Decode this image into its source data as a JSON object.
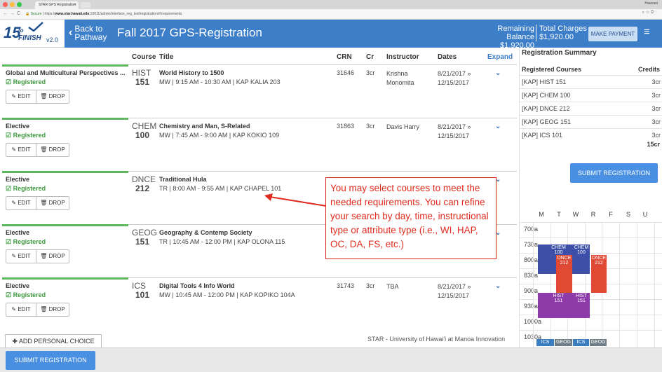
{
  "browser": {
    "tab_title": "STAR GPS Registration",
    "user": "Haunani",
    "url_secure": "Secure",
    "url_scheme": "https://",
    "url_host": "www.star.hawaii.edu",
    "url_path": ":10011/admin/interface_reg_test/registration/#/requirements"
  },
  "header": {
    "logo_num": "15",
    "logo_to": "to",
    "logo_finish": "FINISH",
    "logo_ver": "v2.0",
    "back_line1": "Back to",
    "back_line2": "Pathway",
    "title": "Fall 2017 GPS-Registration",
    "balance_label": "Remaining Balance",
    "balance_value": "$1,920.00",
    "charges_label": "Total Charges",
    "charges_value": "$1,920.00",
    "make_payment": "MAKE PAYMENT"
  },
  "columns": {
    "course": "Course",
    "title": "Title",
    "crn": "CRN",
    "cr": "Cr",
    "instructor": "Instructor",
    "dates": "Dates",
    "expand": "Expand"
  },
  "labels": {
    "registered": "Registered",
    "edit": "EDIT",
    "drop": "DROP"
  },
  "courses": [
    {
      "category": "Global and Multicultural Perspectives ...",
      "subject": "HIST",
      "number": "151",
      "title": "World History to 1500",
      "schedule": "MW | 9:15 AM - 10:30 AM | KAP KALIA 203",
      "crn": "31646",
      "credits": "3cr",
      "instructor_1": "Krishna",
      "instructor_2": "Monomita",
      "date_start": "8/21/2017",
      "date_end": "12/15/2017"
    },
    {
      "category": "Elective",
      "subject": "CHEM",
      "number": "100",
      "title": "Chemistry and Man, S-Related",
      "schedule": "MW | 7:45 AM - 9:00 AM | KAP KOKIO 109",
      "crn": "31863",
      "credits": "3cr",
      "instructor_1": "Davis Harry",
      "instructor_2": "",
      "date_start": "8/21/2017",
      "date_end": "12/15/2017"
    },
    {
      "category": "Elective",
      "subject": "DNCE",
      "number": "212",
      "title": "Traditional Hula",
      "schedule": "TR | 8:00 AM - 9:55 AM | KAP CHAPEL 101",
      "crn": "",
      "credits": "",
      "instructor_1": "",
      "instructor_2": "",
      "date_start": "",
      "date_end": ""
    },
    {
      "category": "Elective",
      "subject": "GEOG",
      "number": "151",
      "title": "Geography & Contemp Society",
      "schedule": "TR | 10:45 AM - 12:00 PM | KAP OLONA 115",
      "crn": "",
      "credits": "",
      "instructor_1": "",
      "instructor_2": "",
      "date_start": "",
      "date_end": ""
    },
    {
      "category": "Elective",
      "subject": "ICS",
      "number": "101",
      "title": "Digital Tools 4 Info World",
      "schedule": "MW | 10:45 AM - 12:00 PM | KAP KOPIKO 104A",
      "crn": "31743",
      "credits": "3cr",
      "instructor_1": "TBA",
      "instructor_2": "",
      "date_start": "8/21/2017",
      "date_end": "12/15/2017"
    }
  ],
  "add_personal": "ADD PERSONAL CHOICE",
  "credit_footer": "STAR - University of Hawai'i at Manoa Innovation",
  "summary": {
    "title": "Registration Summary",
    "head_courses": "Registered Courses",
    "head_credits": "Credits",
    "rows": [
      {
        "name": "[KAP] HIST 151",
        "cr": "3cr"
      },
      {
        "name": "[KAP] CHEM 100",
        "cr": "3cr"
      },
      {
        "name": "[KAP] DNCE 212",
        "cr": "3cr"
      },
      {
        "name": "[KAP] GEOG 151",
        "cr": "3cr"
      },
      {
        "name": "[KAP] ICS 101",
        "cr": "3cr"
      }
    ],
    "total": "15cr",
    "submit": "SUBMIT REGISTRATION"
  },
  "calendar": {
    "days": [
      "M",
      "T",
      "W",
      "R",
      "F",
      "S",
      "U"
    ],
    "times": [
      "700a",
      "730a",
      "800a",
      "830a",
      "900a",
      "930a",
      "1000a",
      "1030a"
    ],
    "blocks": [
      {
        "l1": "CHEM",
        "l2": "100",
        "color": "#3d4fa8"
      },
      {
        "l1": "DNCE",
        "l2": "212",
        "color": "#e04a35"
      },
      {
        "l1": "CHEM",
        "l2": "100",
        "color": "#3d4fa8"
      },
      {
        "l1": "DNCE",
        "l2": "212",
        "color": "#e04a35"
      },
      {
        "l1": "HIST",
        "l2": "151",
        "color": "#8e3aa8"
      },
      {
        "l1": "HIST",
        "l2": "151",
        "color": "#8e3aa8"
      },
      {
        "l1": "ICS",
        "l2": "",
        "color": "#3a7ec0"
      },
      {
        "l1": "GEOG",
        "l2": "",
        "color": "#6f7d86"
      },
      {
        "l1": "ICS",
        "l2": "",
        "color": "#3a7ec0"
      },
      {
        "l1": "GEOG",
        "l2": "",
        "color": "#6f7d86"
      }
    ]
  },
  "submit_bottom": "SUBMIT REGISTRATION",
  "annotation": "You may select courses to meet the needed requirements. You can refine your search by day, time, instructional type or attribute type (i.e., WI, HAP, OC, DA, FS, etc.)"
}
